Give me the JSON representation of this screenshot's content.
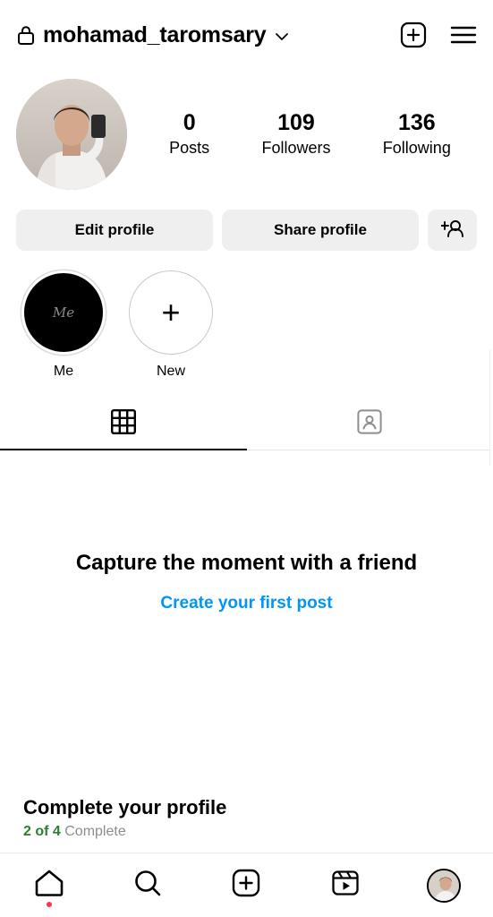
{
  "topbar": {
    "lock_icon": "lock-icon",
    "username": "mohamad_taromsary",
    "chevron_icon": "chevron-down-icon",
    "create_icon": "new-post-icon",
    "menu_icon": "hamburger-menu-icon"
  },
  "profile": {
    "avatar_name": "profile-avatar",
    "stats": [
      {
        "number": "0",
        "label": "Posts"
      },
      {
        "number": "109",
        "label": "Followers"
      },
      {
        "number": "136",
        "label": "Following"
      }
    ]
  },
  "actions": {
    "edit_profile": "Edit profile",
    "share_profile": "Share profile",
    "add_person_icon": "add-person-icon"
  },
  "highlights": [
    {
      "label": "Me",
      "inner_text": "Me",
      "type": "story"
    },
    {
      "label": "New",
      "inner_text": "+",
      "type": "new"
    }
  ],
  "tabs": [
    {
      "name": "grid",
      "icon": "grid-icon",
      "active": true
    },
    {
      "name": "tagged",
      "icon": "tagged-person-icon",
      "active": false
    }
  ],
  "empty_state": {
    "title": "Capture the moment with a friend",
    "link": "Create your first post"
  },
  "complete_profile": {
    "title": "Complete your profile",
    "progress": "2 of 4",
    "progress_suffix": "Complete"
  },
  "bottom_nav": [
    {
      "name": "home",
      "icon": "home-icon",
      "has_dot": true
    },
    {
      "name": "search",
      "icon": "search-icon",
      "has_dot": false
    },
    {
      "name": "create",
      "icon": "create-icon",
      "has_dot": false
    },
    {
      "name": "reels",
      "icon": "reels-icon",
      "has_dot": false
    },
    {
      "name": "profile",
      "icon": "profile-avatar-icon",
      "has_dot": false
    }
  ],
  "colors": {
    "link_blue": "#0095f6",
    "button_gray": "#efefef",
    "progress_green": "#2e7d32",
    "notification_red": "#ff3250"
  }
}
